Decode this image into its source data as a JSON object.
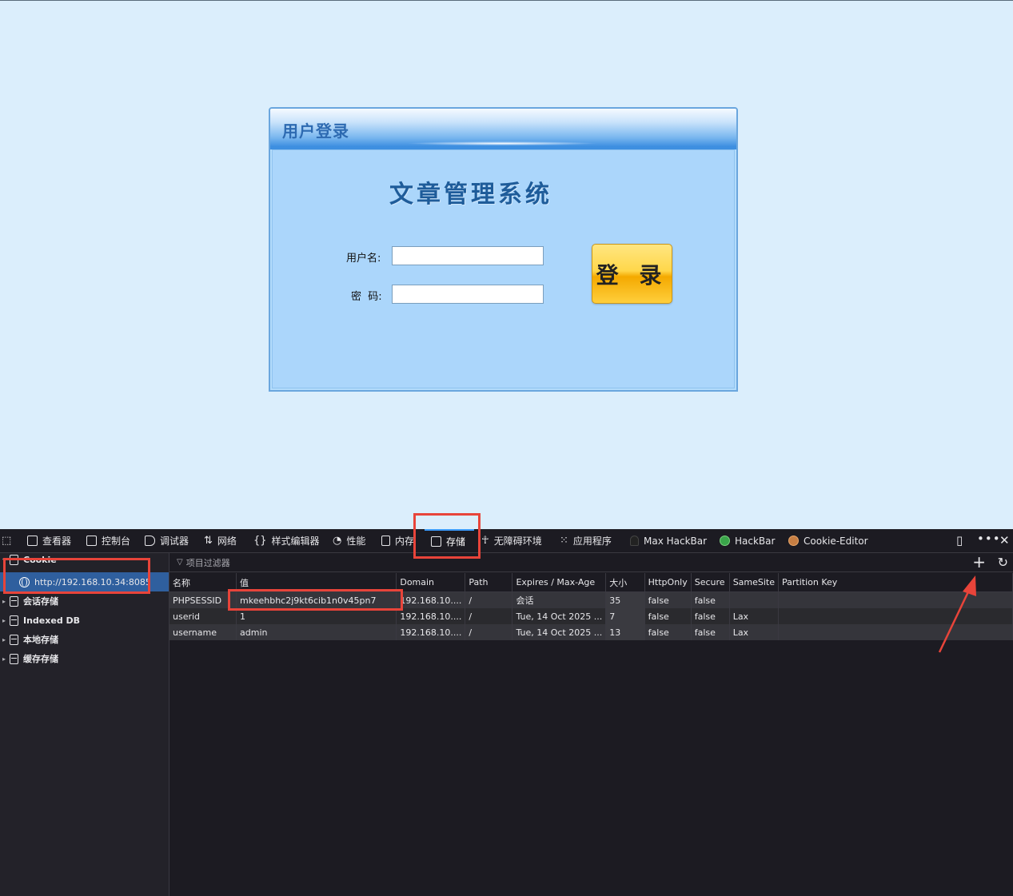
{
  "webpage": {
    "login_header_title": "用户登录",
    "system_title": "文章管理系统",
    "username_label": "用户名:",
    "password_label": "密  码:",
    "username_value": "",
    "password_value": "",
    "login_button_label": "登 录"
  },
  "devtools": {
    "tabs": [
      {
        "label": "查看器",
        "icon": "inspector-icon"
      },
      {
        "label": "控制台",
        "icon": "console-icon"
      },
      {
        "label": "调试器",
        "icon": "debugger-icon"
      },
      {
        "label": "网络",
        "icon": "network-icon"
      },
      {
        "label": "样式编辑器",
        "icon": "style-editor-icon"
      },
      {
        "label": "性能",
        "icon": "performance-icon"
      },
      {
        "label": "内存",
        "icon": "memory-icon"
      },
      {
        "label": "存储",
        "icon": "storage-icon",
        "active": true
      },
      {
        "label": "无障碍环境",
        "icon": "accessibility-icon"
      },
      {
        "label": "应用程序",
        "icon": "application-icon"
      },
      {
        "label": "Max HackBar",
        "icon": "max-hackbar-icon"
      },
      {
        "label": "HackBar",
        "icon": "hackbar-icon"
      },
      {
        "label": "Cookie-Editor",
        "icon": "cookie-editor-icon"
      }
    ],
    "sidebar": {
      "cookie_label": "Cookie",
      "cookie_host": "http://192.168.10.34:8085",
      "session_storage": "会话存储",
      "indexed_db": "Indexed DB",
      "local_storage": "本地存储",
      "cache_storage": "缓存存储"
    },
    "filter_placeholder": "项目过滤器",
    "table": {
      "columns": [
        "名称",
        "值",
        "Domain",
        "Path",
        "Expires / Max-Age",
        "大小",
        "HttpOnly",
        "Secure",
        "SameSite",
        "Partition Key"
      ],
      "rows": [
        [
          "PHPSESSID",
          "mkeehbhc2j9kt6cib1n0v45pn7",
          "192.168.10....",
          "/",
          "会话",
          "35",
          "false",
          "false",
          "",
          ""
        ],
        [
          "userid",
          "1",
          "192.168.10....",
          "/",
          "Tue, 14 Oct 2025 ...",
          "7",
          "false",
          "false",
          "Lax",
          ""
        ],
        [
          "username",
          "admin",
          "192.168.10....",
          "/",
          "Tue, 14 Oct 2025 ...",
          "13",
          "false",
          "false",
          "Lax",
          ""
        ]
      ]
    },
    "accent_color": "#3b9cff",
    "annotation_color": "#e8443a"
  }
}
